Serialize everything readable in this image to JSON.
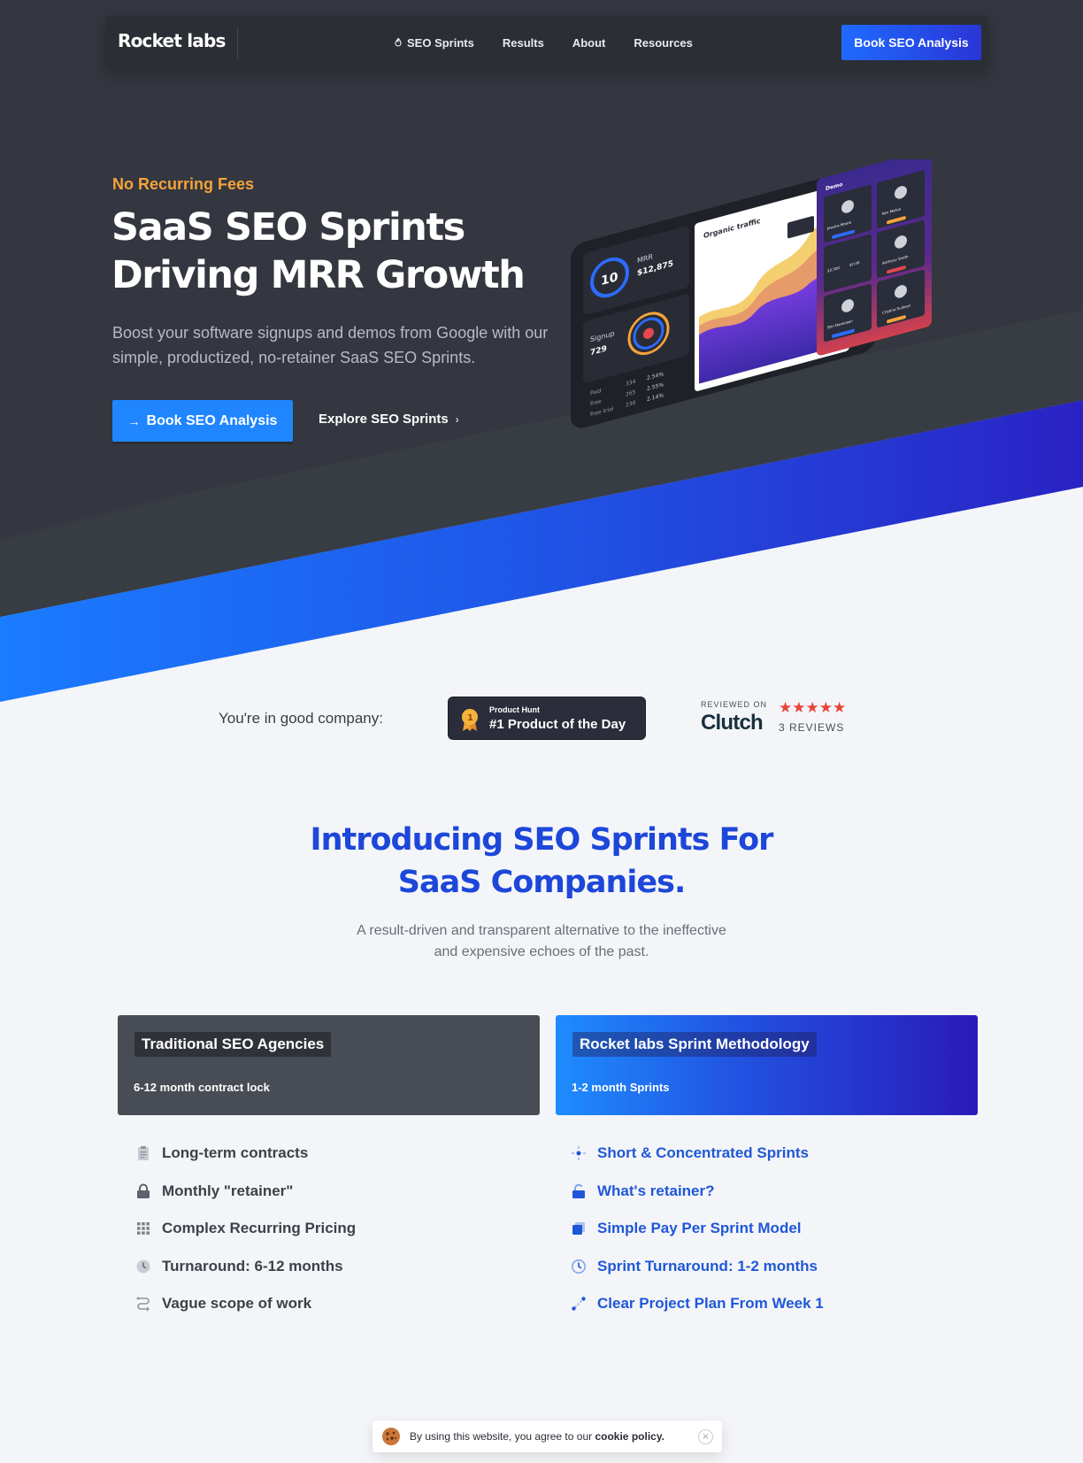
{
  "brand": {
    "name": "Rocket labs"
  },
  "nav": {
    "items": [
      {
        "label": "SEO Sprints",
        "icon": "flame-icon"
      },
      {
        "label": "Results"
      },
      {
        "label": "About"
      },
      {
        "label": "Resources"
      }
    ],
    "cta_label": "Book SEO Analysis"
  },
  "hero": {
    "eyebrow": "No Recurring Fees",
    "title_line1": "SaaS SEO Sprints",
    "title_line2": "Driving MRR Growth",
    "subtitle": "Boost your software signups and demos from Google with our simple, productized, no-retainer SaaS SEO Sprints.",
    "primary_cta": "Book SEO Analysis",
    "secondary_cta": "Explore SEO Sprints",
    "dashboard": {
      "mrr_label": "MRR",
      "mrr_value": "$12,875",
      "gauge_value": "10",
      "signup_label": "Signup",
      "signup_value": "729",
      "chart_title": "Organic traffic",
      "table_rows": [
        {
          "label": "Paid",
          "n": "334",
          "pct": "2.54%"
        },
        {
          "label": "Free",
          "n": "265",
          "pct": "2.55%"
        },
        {
          "label": "Free trial",
          "n": "230",
          "pct": "2.14%"
        }
      ],
      "panel_title": "Demo",
      "people": [
        "Jessica Moore",
        "Ken Mafua",
        "Anthony Smith",
        "Stin Danielson",
        "Cristine Sullivan"
      ],
      "stat_a": "$3,500",
      "stat_b": "$2.00"
    }
  },
  "proof": {
    "label": "You're in good company:",
    "producthunt_small": "Product Hunt",
    "producthunt_big": "#1 Product of the Day",
    "clutch_reviewed": "REVIEWED ON",
    "clutch_name": "Clutch",
    "clutch_stars": "★★★★★",
    "clutch_reviews": "3 REVIEWS"
  },
  "intro": {
    "title_line1": "Introducing SEO Sprints For",
    "title_line2": "SaaS Companies.",
    "subtitle_line1": "A result-driven and transparent alternative to the ineffective",
    "subtitle_line2": "and expensive echoes of the past."
  },
  "compare": {
    "left": {
      "title": "Traditional SEO Agencies",
      "note": "6-12 month contract lock",
      "items": [
        {
          "label": "Long-term contracts",
          "icon": "clipboard-icon"
        },
        {
          "label": "Monthly \"retainer\"",
          "icon": "lock-icon"
        },
        {
          "label": "Complex Recurring Pricing",
          "icon": "grid-icon"
        },
        {
          "label": "Turnaround: 6-12 months",
          "icon": "clock-icon"
        },
        {
          "label": "Vague scope of work",
          "icon": "route-icon"
        }
      ]
    },
    "right": {
      "title": "Rocket labs Sprint Methodology",
      "note": "1-2 month Sprints",
      "items": [
        {
          "label": "Short & Concentrated Sprints",
          "icon": "focus-icon"
        },
        {
          "label": "What's retainer?",
          "icon": "unlock-icon"
        },
        {
          "label": "Simple Pay Per Sprint Model",
          "icon": "stack-icon"
        },
        {
          "label": "Sprint Turnaround: 1-2 months",
          "icon": "clock-icon"
        },
        {
          "label": "Clear Project Plan From Week 1",
          "icon": "path-icon"
        }
      ]
    }
  },
  "cookie": {
    "text": "By using this website, you agree to our",
    "link": "cookie policy.",
    "close": "×"
  },
  "colors": {
    "hero_bg": "#33363e",
    "accent_blue": "#1f86ff",
    "headline_blue": "#1d47d9",
    "eyebrow_orange": "#f5a33b"
  }
}
